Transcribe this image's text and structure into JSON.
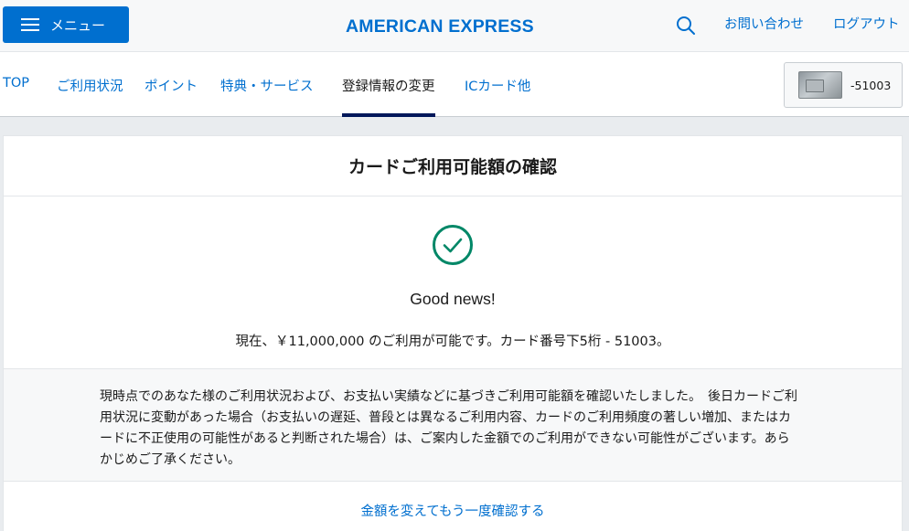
{
  "header": {
    "menu_label": "メニュー",
    "logo_text": "AMERICAN EXPRESS",
    "contact_label": "お問い合わせ",
    "logout_label": "ログアウト"
  },
  "nav": {
    "tabs": [
      {
        "label": "TOP"
      },
      {
        "label": "ご利用状況"
      },
      {
        "label": "ポイント"
      },
      {
        "label": "特典・サービス"
      },
      {
        "label": "登録情報の変更"
      },
      {
        "label": "ICカード他"
      }
    ],
    "active_tab": "登録情報の変更",
    "card_number": "-51003"
  },
  "content": {
    "title": "カードご利用可能額の確認",
    "headline": "Good news!",
    "availability": "現在、￥11,000,000 のご利用が可能です。カード番号下5桁 - 51003。",
    "note": "現時点でのあなた様のご利用状況および、お支払い実績などに基づきご利用可能額を確認いたしました。　後日カードご利用状況に変動があった場合（お支払いの遅延、普段とは異なるご利用内容、カードのご利用頻度の著しい増加、またはカードに不正使用の可能性があると判断された場合）は、ご案内した金額でのご利用ができない可能性がございます。あらかじめご了承ください。",
    "retry_link": "金額を変えてもう一度確認する"
  },
  "colors": {
    "brand_blue": "#006fcf",
    "navy": "#00175a",
    "success_green": "#008767"
  },
  "icons": {
    "menu": "hamburger-icon",
    "search": "search-icon",
    "success": "check-circle-icon",
    "card": "card-thumbnail"
  }
}
